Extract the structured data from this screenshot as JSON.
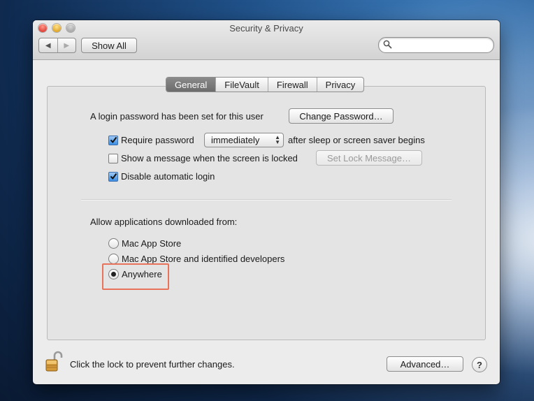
{
  "window": {
    "title": "Security & Privacy"
  },
  "toolbar": {
    "back_label": "◀",
    "forward_label": "▶",
    "show_all_label": "Show All",
    "search_placeholder": ""
  },
  "tabs": [
    {
      "label": "General",
      "active": true
    },
    {
      "label": "FileVault",
      "active": false
    },
    {
      "label": "Firewall",
      "active": false
    },
    {
      "label": "Privacy",
      "active": false
    }
  ],
  "general": {
    "login_password_text": "A login password has been set for this user",
    "change_password_label": "Change Password…",
    "require_password": {
      "checked": true,
      "label": "Require password",
      "popup_value": "immediately",
      "suffix": "after sleep or screen saver begins"
    },
    "show_message": {
      "checked": false,
      "label": "Show a message when the screen is locked",
      "button_label": "Set Lock Message…"
    },
    "disable_auto_login": {
      "checked": true,
      "label": "Disable automatic login"
    },
    "allow_apps_heading": "Allow applications downloaded from:",
    "allow_apps_options": [
      {
        "label": "Mac App Store",
        "selected": false
      },
      {
        "label": "Mac App Store and identified developers",
        "selected": false
      },
      {
        "label": "Anywhere",
        "selected": true
      }
    ]
  },
  "footer": {
    "lock_text": "Click the lock to prevent further changes.",
    "advanced_label": "Advanced…",
    "help_label": "?"
  },
  "colors": {
    "highlight_border": "#e8735a",
    "checkbox_on": "#3d8ee3"
  }
}
